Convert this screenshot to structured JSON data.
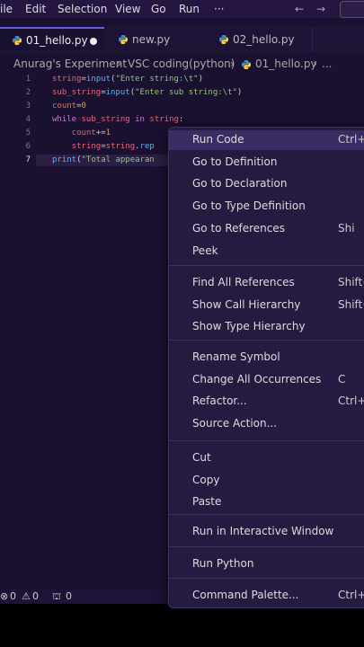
{
  "menubar": {
    "items": [
      "ile",
      "Edit",
      "Selection",
      "View",
      "Go",
      "Run",
      "···"
    ],
    "back": "←",
    "forward": "→"
  },
  "tabs": [
    {
      "label": "01_hello.py",
      "active": true,
      "modified": true
    },
    {
      "label": "new.py"
    },
    {
      "label": "02_hello.py"
    }
  ],
  "breadcrumb": [
    "Anurag's Experiment",
    "VSC coding(python)",
    "01_hello.py",
    "..."
  ],
  "editor": {
    "line_numbers": [
      "1",
      "2",
      "3",
      "4",
      "5",
      "6",
      "7"
    ],
    "lines": [
      {
        "tokens": [
          [
            "id",
            "string"
          ],
          [
            "pl",
            "="
          ],
          [
            "fn",
            "input"
          ],
          [
            "pl",
            "("
          ],
          [
            "str",
            "\"Enter string:\\t\""
          ],
          [
            "pl",
            ")"
          ]
        ]
      },
      {
        "tokens": [
          [
            "id",
            "sub_string"
          ],
          [
            "pl",
            "="
          ],
          [
            "fn",
            "input"
          ],
          [
            "pl",
            "("
          ],
          [
            "str",
            "\"Enter sub string:\\t\""
          ],
          [
            "pl",
            ")"
          ]
        ]
      },
      {
        "tokens": [
          [
            "id",
            "count"
          ],
          [
            "pl",
            "="
          ],
          [
            "num",
            "0"
          ]
        ]
      },
      {
        "tokens": [
          [
            "kw",
            "while"
          ],
          [
            "pl",
            " "
          ],
          [
            "id",
            "sub_string"
          ],
          [
            "pl",
            " "
          ],
          [
            "kw",
            "in"
          ],
          [
            "pl",
            " "
          ],
          [
            "id",
            "string"
          ],
          [
            "pl",
            ":"
          ]
        ]
      },
      {
        "tokens": [
          [
            "pl",
            "    "
          ],
          [
            "id",
            "count"
          ],
          [
            "pl",
            "+="
          ],
          [
            "num",
            "1"
          ]
        ]
      },
      {
        "tokens": [
          [
            "pl",
            "    "
          ],
          [
            "id",
            "string"
          ],
          [
            "pl",
            "="
          ],
          [
            "id",
            "string"
          ],
          [
            "pl",
            "."
          ],
          [
            "fn",
            "rep"
          ]
        ]
      },
      {
        "tokens": [
          [
            "fn",
            "print"
          ],
          [
            "pl",
            "("
          ],
          [
            "str",
            "\"Total appearan"
          ]
        ]
      }
    ]
  },
  "status": {
    "errors": "0",
    "warnings": "0",
    "ports": "0"
  },
  "context_menu": {
    "groups": [
      [
        {
          "label": "Run Code",
          "shortcut": "Ctrl+",
          "highlighted": true
        },
        {
          "label": "Go to Definition",
          "shortcut": ""
        },
        {
          "label": "Go to Declaration",
          "shortcut": ""
        },
        {
          "label": "Go to Type Definition",
          "shortcut": ""
        },
        {
          "label": "Go to References",
          "shortcut": "Shi"
        },
        {
          "label": "Peek",
          "shortcut": ""
        }
      ],
      [
        {
          "label": "Find All References",
          "shortcut": "Shift+A"
        },
        {
          "label": "Show Call Hierarchy",
          "shortcut": "Shift+"
        },
        {
          "label": "Show Type Hierarchy",
          "shortcut": ""
        }
      ],
      [
        {
          "label": "Rename Symbol",
          "shortcut": ""
        },
        {
          "label": "Change All Occurrences",
          "shortcut": "C"
        },
        {
          "label": "Refactor...",
          "shortcut": "Ctrl+S"
        },
        {
          "label": "Source Action...",
          "shortcut": ""
        }
      ],
      [
        {
          "label": "Cut",
          "shortcut": ""
        },
        {
          "label": "Copy",
          "shortcut": ""
        },
        {
          "label": "Paste",
          "shortcut": ""
        }
      ],
      [
        {
          "label": "Run in Interactive Window",
          "shortcut": ""
        }
      ],
      [
        {
          "label": "Run Python",
          "shortcut": ""
        }
      ],
      [
        {
          "label": "Command Palette...",
          "shortcut": "Ctrl+S"
        }
      ]
    ]
  },
  "colors": {
    "accent": "#6c5ce7",
    "background": "#1a1030",
    "menu_bg": "#251a3f"
  },
  "icons": {
    "python_file": "python-file-icon",
    "error": "error-icon",
    "warning": "warning-icon",
    "ports": "ports-icon"
  }
}
